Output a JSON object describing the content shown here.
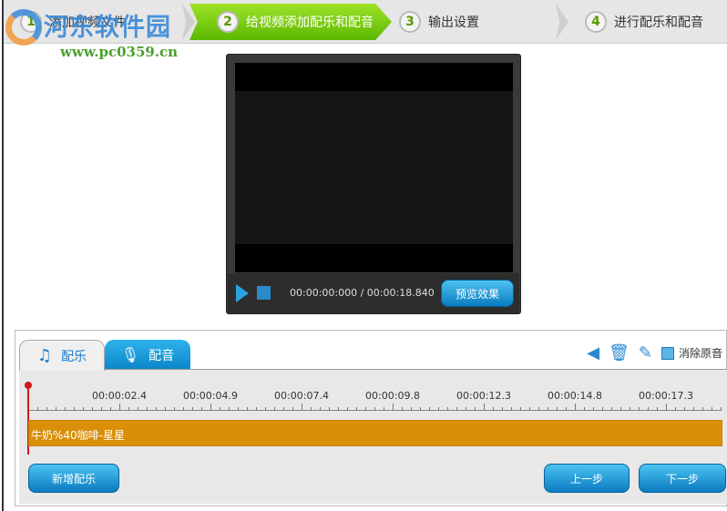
{
  "watermark": {
    "name": "河东软件园",
    "url": "www.pc0359.cn"
  },
  "steps": [
    {
      "num": "1",
      "label": "添加视频文件"
    },
    {
      "num": "2",
      "label": "给视频添加配乐和配音"
    },
    {
      "num": "3",
      "label": "输出设置"
    },
    {
      "num": "4",
      "label": "进行配乐和配音"
    }
  ],
  "player": {
    "time": "00:00:00:000 / 00:00:18.840",
    "preview_label": "预览效果"
  },
  "tabs": [
    {
      "label": "配乐",
      "icon": "music-note-icon"
    },
    {
      "label": "配音",
      "icon": "microphone-icon"
    }
  ],
  "tools": {
    "remove_original_label": "消除原音",
    "remove_original_checked": false
  },
  "timeline": {
    "labels": [
      "00:00:02.4",
      "00:00:04.9",
      "00:00:07.4",
      "00:00:09.8",
      "00:00:12.3",
      "00:00:14.8",
      "00:00:17.3"
    ],
    "track_label": "牛奶%40咖啡-星星"
  },
  "buttons": {
    "add_music": "新增配乐",
    "prev": "上一步",
    "next": "下一步"
  }
}
